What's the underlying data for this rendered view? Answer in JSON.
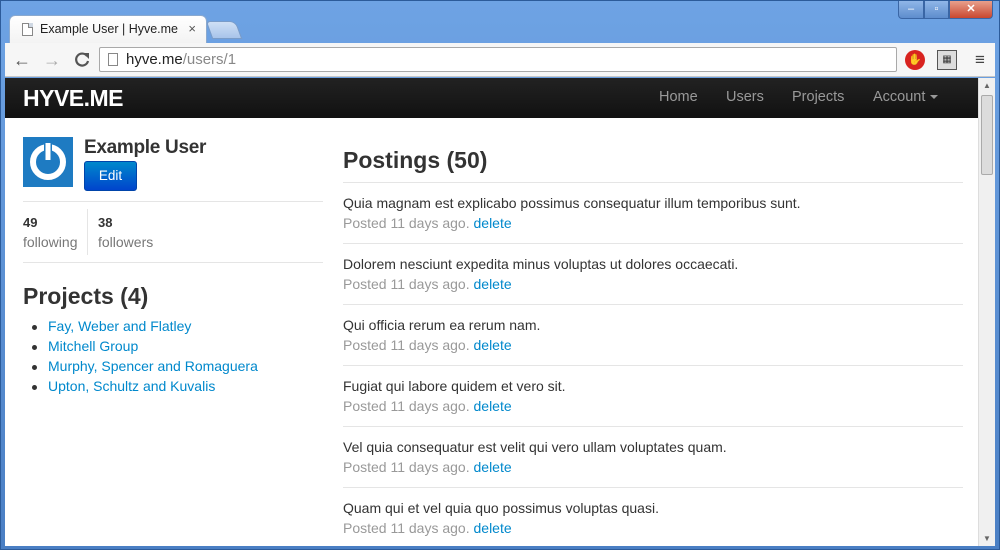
{
  "browser": {
    "tab_title": "Example User | Hyve.me",
    "tab_close": "×",
    "url_host": "hyve.me",
    "url_path": "/users/1",
    "window_min": "–",
    "window_max": "▫",
    "window_close": "✕",
    "back": "←",
    "forward": "→",
    "reload": "C",
    "menu": "≡"
  },
  "navbar": {
    "brand": "HYVE.ME",
    "links": [
      "Home",
      "Users",
      "Projects",
      "Account"
    ]
  },
  "profile": {
    "name": "Example User",
    "edit_label": "Edit",
    "following_count": "49",
    "following_label": "following",
    "followers_count": "38",
    "followers_label": "followers"
  },
  "projects": {
    "title": "Projects (4)",
    "items": [
      "Fay, Weber and Flatley",
      "Mitchell Group",
      "Murphy, Spencer and Romaguera",
      "Upton, Schultz and Kuvalis"
    ]
  },
  "postings": {
    "title": "Postings (50)",
    "items": [
      {
        "content": "Quia magnam est explicabo possimus consequatur illum temporibus sunt.",
        "time": "Posted 11 days ago.",
        "action": "delete"
      },
      {
        "content": "Dolorem nesciunt expedita minus voluptas ut dolores occaecati.",
        "time": "Posted 11 days ago.",
        "action": "delete"
      },
      {
        "content": "Qui officia rerum ea rerum nam.",
        "time": "Posted 11 days ago.",
        "action": "delete"
      },
      {
        "content": "Fugiat qui labore quidem et vero sit.",
        "time": "Posted 11 days ago.",
        "action": "delete"
      },
      {
        "content": "Vel quia consequatur est velit qui vero ullam voluptates quam.",
        "time": "Posted 11 days ago.",
        "action": "delete"
      },
      {
        "content": "Quam qui et vel quia quo possimus voluptas quasi.",
        "time": "Posted 11 days ago.",
        "action": "delete"
      }
    ]
  },
  "colors": {
    "link": "#0088cc",
    "navbar": "#1b1b1b",
    "button": "#0066cc"
  }
}
